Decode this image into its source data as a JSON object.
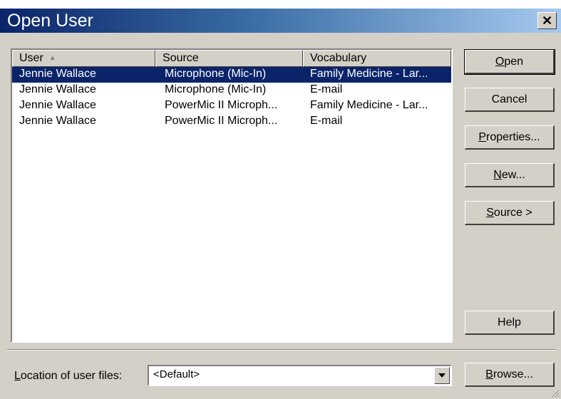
{
  "window": {
    "title": "Open User",
    "close_glyph": "✕"
  },
  "list": {
    "columns": [
      "User",
      "Source",
      "Vocabulary"
    ],
    "rows": [
      {
        "user": "Jennie Wallace",
        "source": "Microphone (Mic-In)",
        "vocabulary": "Family Medicine - Lar...",
        "selected": true
      },
      {
        "user": "Jennie Wallace",
        "source": "Microphone (Mic-In)",
        "vocabulary": "E-mail",
        "selected": false
      },
      {
        "user": "Jennie Wallace",
        "source": "PowerMic II Microph...",
        "vocabulary": "Family Medicine - Lar...",
        "selected": false
      },
      {
        "user": "Jennie Wallace",
        "source": "PowerMic II Microph...",
        "vocabulary": "E-mail",
        "selected": false
      }
    ]
  },
  "buttons": {
    "open": {
      "mnemonic": "O",
      "rest": "pen"
    },
    "cancel": "Cancel",
    "properties": {
      "mnemonic": "P",
      "rest": "roperties..."
    },
    "new": {
      "mnemonic": "N",
      "rest": "ew..."
    },
    "source": {
      "mnemonic": "S",
      "rest": "ource >"
    },
    "help": "Help",
    "browse": {
      "mnemonic": "B",
      "rest": "rowse..."
    }
  },
  "location": {
    "label_mnemonic": "L",
    "label_rest": "ocation of user files:",
    "value": "<Default>"
  },
  "colors": {
    "selection": "#0a246a",
    "dialog_face": "#d4d0c8"
  }
}
